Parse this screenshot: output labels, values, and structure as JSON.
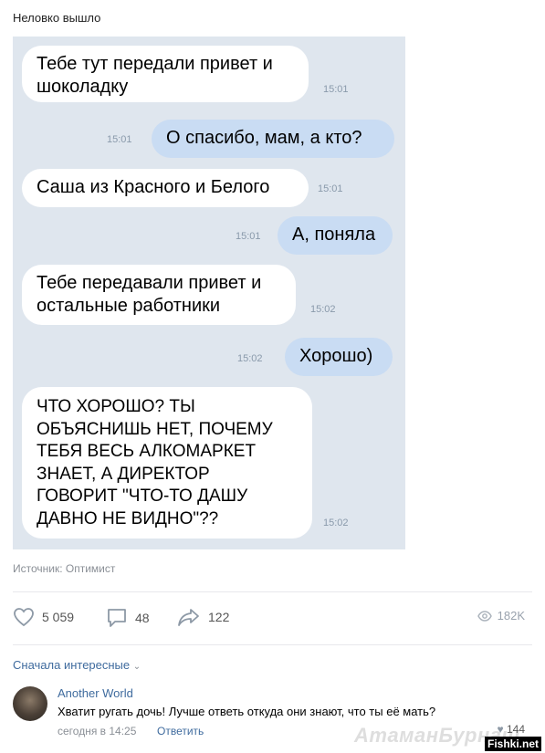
{
  "post": {
    "title": "Неловко вышло",
    "source": "Источник: Оптимист"
  },
  "messages": [
    {
      "line1": "Тебе тут передали привет и",
      "line2": "шоколадку",
      "time": "15:01"
    },
    {
      "text": "О спасибо, мам, а кто?",
      "time": "15:01"
    },
    {
      "text": "Саша из Красного и Белого",
      "time": "15:01"
    },
    {
      "text": "А, поняла",
      "time": "15:01"
    },
    {
      "line1": "Тебе передавали привет и",
      "line2": "остальные работники",
      "time": "15:02"
    },
    {
      "text": "Хорошо)",
      "time": "15:02"
    },
    {
      "lines": [
        "ЧТО ХОРОШО? ТЫ",
        "ОБЪЯСНИШЬ НЕТ, ПОЧЕМУ",
        "ТЕБЯ ВЕСЬ АЛКОМАРКЕТ",
        "ЗНАЕТ, А ДИРЕКТОР",
        "ГОВОРИТ \"ЧТО-ТО ДАШУ",
        "ДАВНО НЕ ВИДНО\"??"
      ],
      "time": "15:02"
    }
  ],
  "actions": {
    "likes": "5 059",
    "comments": "48",
    "shares": "122",
    "views": "182K"
  },
  "comments_section": {
    "sort_label": "Сначала интересные",
    "comment": {
      "author": "Another World",
      "text": "Хватит ругать дочь! Лучше ответь откуда они знают, что ты её мать?",
      "date": "сегодня в 14:25",
      "reply": "Ответить",
      "likes": "144"
    }
  },
  "watermark": {
    "site": "Fishki.net",
    "ghost": "АтаманБурнаш"
  },
  "colors": {
    "chat_bg": "#dfe6ee",
    "incoming": "#ffffff",
    "outgoing": "#c9dcf3",
    "link": "#3f6b9e"
  }
}
